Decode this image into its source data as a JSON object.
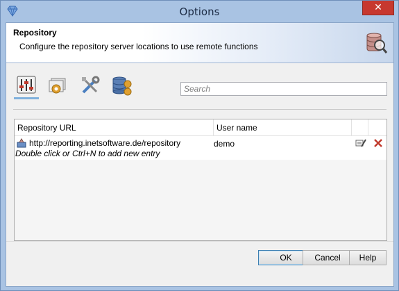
{
  "window": {
    "title": "Options"
  },
  "header": {
    "title": "Repository",
    "description": "Configure the repository server locations to use remote functions"
  },
  "toolbar": {
    "items": [
      {
        "icon": "sliders-icon",
        "selected": true
      },
      {
        "icon": "folder-gear-icon",
        "selected": false
      },
      {
        "icon": "tools-icon",
        "selected": false
      },
      {
        "icon": "database-gear-icon",
        "selected": false
      }
    ],
    "search_placeholder": "Search"
  },
  "table": {
    "columns": [
      "Repository URL",
      "User name"
    ],
    "rows": [
      {
        "url": "http://reporting.inetsoftware.de/repository",
        "user": "demo"
      }
    ],
    "hint": "Double click or Ctrl+N to add new entry"
  },
  "buttons": {
    "ok": "OK",
    "cancel": "Cancel",
    "help": "Help"
  },
  "colors": {
    "titlebar": "#a9c3e3",
    "close": "#c7382f",
    "selection_accent": "#7fb0dd"
  }
}
